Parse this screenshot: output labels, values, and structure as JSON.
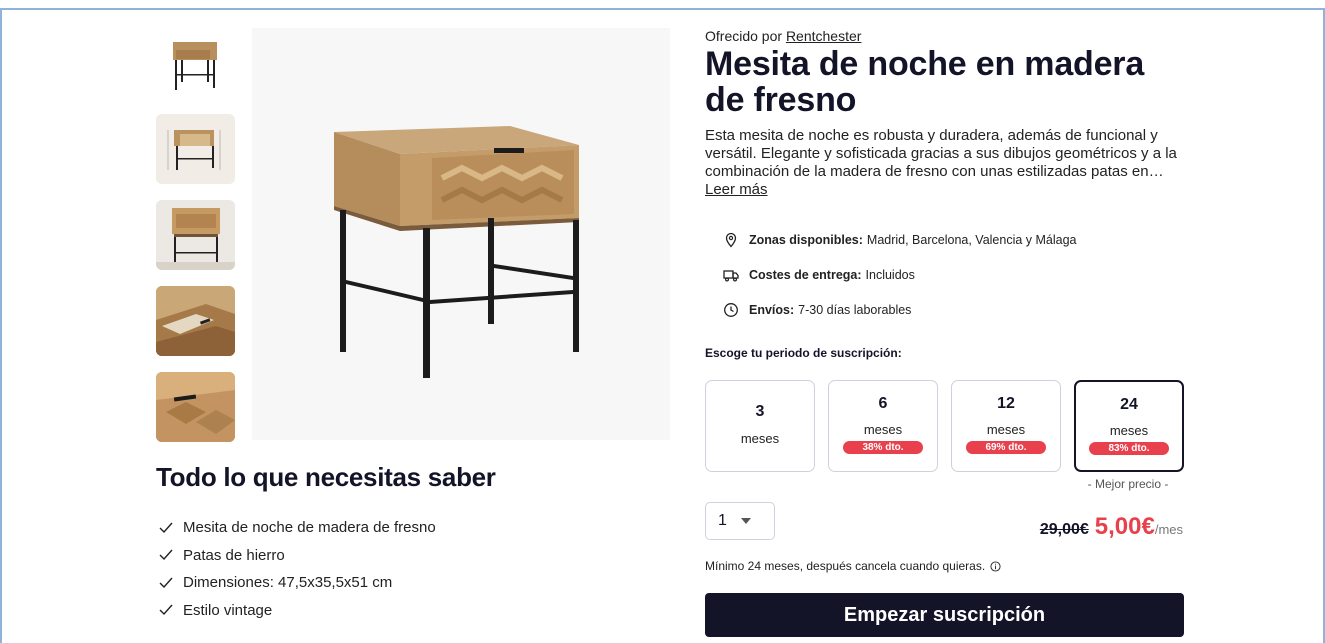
{
  "product": {
    "offered_prefix": "Ofrecido por",
    "seller": "Rentchester",
    "title": "Mesita de noche en madera de fresno",
    "description": "Esta mesita de noche es robusta y duradera, además de funcional y versátil. Elegante y sofisticada gracias a sus dibujos geométricos y a la combinación de la madera de fresno con unas estilizadas patas en…",
    "read_more": "Leer más"
  },
  "gallery": {
    "thumbnails": [
      "thumbnail-front",
      "thumbnail-dimensions",
      "thumbnail-side",
      "thumbnail-drawer-open",
      "thumbnail-detail"
    ]
  },
  "info": {
    "zones_label": "Zonas disponibles:",
    "zones_value": "Madrid, Barcelona, Valencia y Málaga",
    "delivery_label": "Costes de entrega:",
    "delivery_value": "Incluidos",
    "shipping_label": "Envíos:",
    "shipping_value": "7-30 días laborables"
  },
  "subscription": {
    "label": "Escoge tu periodo de suscripción:",
    "plans": [
      {
        "months": "3",
        "unit": "meses",
        "badge": ""
      },
      {
        "months": "6",
        "unit": "meses",
        "badge": "38% dto."
      },
      {
        "months": "12",
        "unit": "meses",
        "badge": "69% dto."
      },
      {
        "months": "24",
        "unit": "meses",
        "badge": "83% dto.",
        "selected": true
      }
    ],
    "best_price": "- Mejor precio -"
  },
  "purchase": {
    "quantity": "1",
    "old_price": "29,00€",
    "new_price": "5,00€",
    "per": "/mes",
    "min_note": "Mínimo 24 meses, después cancela cuando quieras.",
    "cta": "Empezar suscripción"
  },
  "knowledge": {
    "title": "Todo lo que necesitas saber",
    "features": [
      "Mesita de noche de madera de fresno",
      "Patas de hierro",
      "Dimensiones: 47,5x35,5x51 cm",
      "Estilo vintage"
    ]
  },
  "colors": {
    "accent": "#e8404c",
    "dark": "#141428",
    "border": "#cfd2dc",
    "frame": "#8fb3d9"
  }
}
